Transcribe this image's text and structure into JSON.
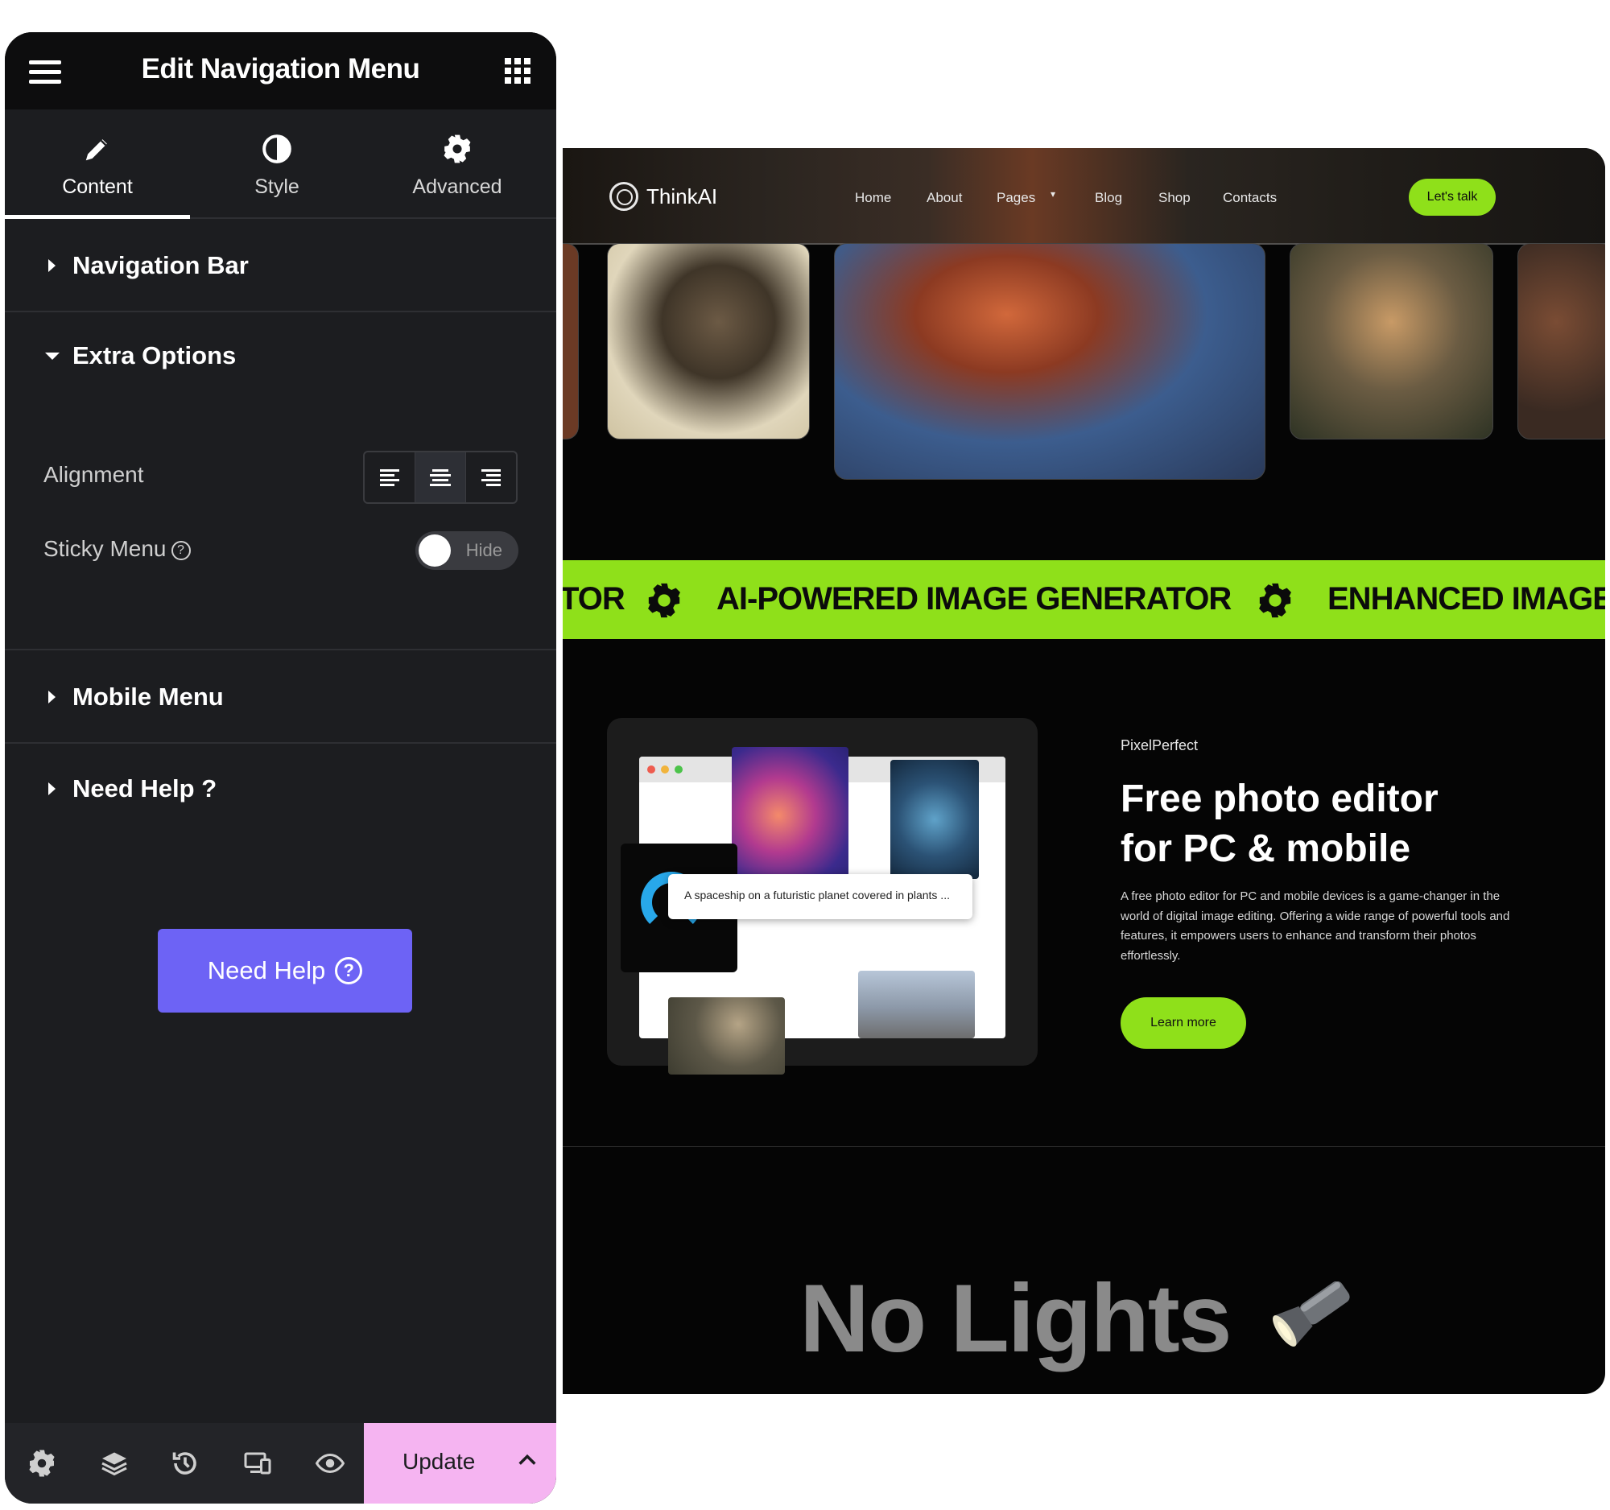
{
  "editor": {
    "title": "Edit Navigation Menu",
    "tabs": [
      {
        "label": "Content",
        "icon": "pencil-icon"
      },
      {
        "label": "Style",
        "icon": "contrast-icon"
      },
      {
        "label": "Advanced",
        "icon": "gear-icon"
      }
    ],
    "sections": {
      "navigation_bar": "Navigation Bar",
      "extra_options": "Extra Options",
      "mobile_menu": "Mobile Menu",
      "need_help": "Need Help ?"
    },
    "alignment_label": "Alignment",
    "alignment_selected": "center",
    "sticky_label": "Sticky Menu",
    "sticky_toggle_text": "Hide",
    "help_glyph": "?",
    "need_help_button": "Need Help",
    "update_label": "Update",
    "accent_color": "#6d63f5",
    "update_color": "#f5b4f1"
  },
  "site": {
    "brand": "ThinkAI",
    "nav": [
      "Home",
      "About",
      "Pages",
      "Blog",
      "Shop",
      "Contacts"
    ],
    "cta": "Let's talk",
    "marquee": [
      "TOR",
      "AI-POWERED IMAGE GENERATOR",
      "ENHANCED IMAGE"
    ],
    "prompt_text": "A spaceship on a futuristic planet covered in plants ...",
    "kicker": "PixelPerfect",
    "headline_line1": "Free photo editor",
    "headline_line2": "for PC & mobile",
    "description": "A free photo editor for PC and mobile devices is a game-changer in the world of digital image editing. Offering a wide range of powerful tools and features, it empowers users to enhance and transform their photos effortlessly.",
    "learn_more": "Learn more",
    "no_lights": "No Lights",
    "accent_color": "#8fe01a"
  }
}
